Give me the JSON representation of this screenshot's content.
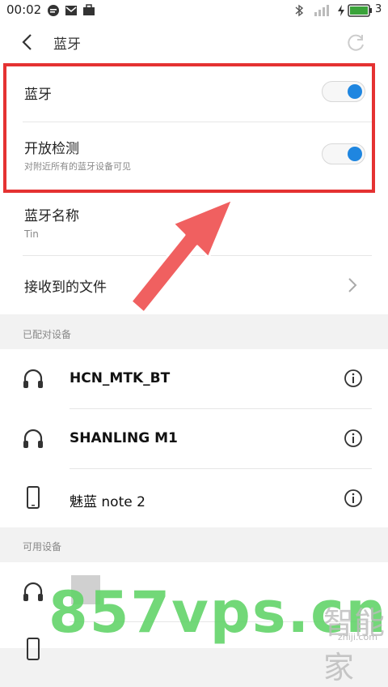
{
  "status_bar": {
    "time": "00:02",
    "battery": "3",
    "icons": [
      "chat-bubble-icon",
      "mail-icon",
      "briefcase-icon",
      "bluetooth-icon",
      "signal-icon",
      "charging-icon",
      "battery-icon"
    ]
  },
  "header": {
    "title": "蓝牙",
    "back_icon": "back-chevron-icon",
    "refresh_icon": "refresh-icon"
  },
  "settings": {
    "bluetooth": {
      "label": "蓝牙",
      "enabled": true
    },
    "discoverable": {
      "label": "开放检测",
      "description": "对附近所有的蓝牙设备可见",
      "enabled": true
    },
    "name": {
      "label": "蓝牙名称",
      "value": "Tin"
    },
    "received_files": {
      "label": "接收到的文件"
    }
  },
  "paired": {
    "header": "已配对设备",
    "devices": [
      {
        "name": "HCN_MTK_BT",
        "icon": "headphones-icon"
      },
      {
        "name": "SHANLING M1",
        "icon": "headphones-icon"
      },
      {
        "name": "魅蓝 note 2",
        "icon": "phone-icon"
      }
    ]
  },
  "available": {
    "header": "可用设备"
  },
  "overlay": {
    "watermark": "857vps.cn",
    "watermark2": "智能家",
    "watermark2_sub": "zhiji.com",
    "highlight_color": "#e53232",
    "arrow_color": "#f06060"
  },
  "colors": {
    "accent": "#1f86e0"
  }
}
